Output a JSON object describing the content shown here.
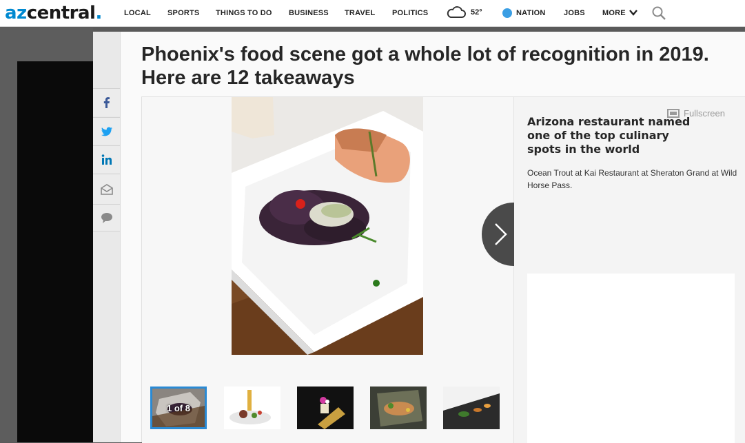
{
  "header": {
    "logo_prefix": "az",
    "logo_main": "central",
    "logo_dot": ".",
    "nav": [
      "LOCAL",
      "SPORTS",
      "THINGS TO DO",
      "BUSINESS",
      "TRAVEL",
      "POLITICS"
    ],
    "weather_temp": "52°",
    "nation": "NATION",
    "jobs": "JOBS",
    "more": "MORE",
    "weather_icon": "cloud-icon",
    "search_icon": "search-icon",
    "accent_color": "#0089d0"
  },
  "share": {
    "items": [
      "facebook-icon",
      "twitter-icon",
      "linkedin-icon",
      "email-icon",
      "comment-icon"
    ],
    "colors": {
      "facebook": "#3b5998",
      "twitter": "#1da1f2",
      "linkedin": "#0077b5"
    }
  },
  "article": {
    "headline": "Phoenix's food scene got a whole lot of recognition in 2019. Here are 12 takeaways"
  },
  "gallery": {
    "fullscreen_label": "Fullscreen",
    "caption_title": "Arizona restaurant named one of the top culinary spots in the world",
    "caption_text": "Ocean Trout at Kai Restaurant at Sheraton Grand at Wild Horse Pass.",
    "counter": "1 of 8",
    "active_color": "#2a8ad4"
  }
}
